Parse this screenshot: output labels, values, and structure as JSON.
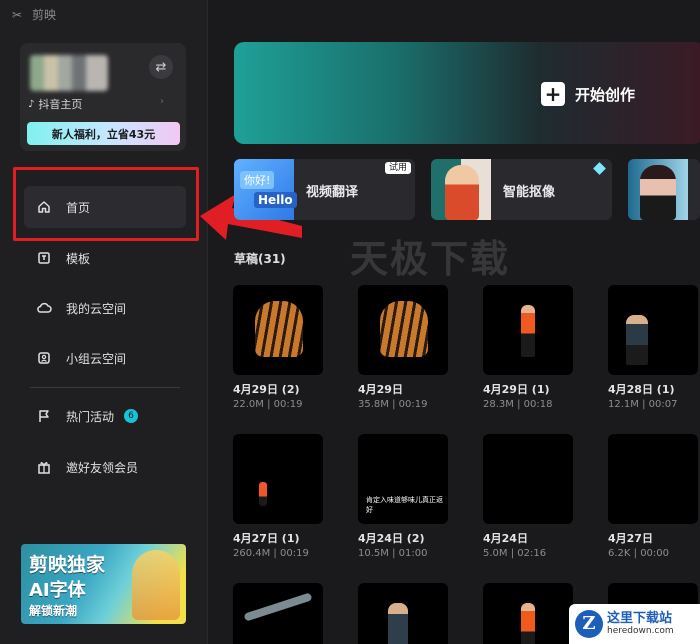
{
  "app": {
    "title": "剪映"
  },
  "user": {
    "douyin_label": "抖音主页",
    "promo": "新人福利，立省43元",
    "switch_icon": "swap-icon"
  },
  "nav": {
    "items": [
      {
        "label": "首页",
        "icon": "home-icon",
        "active": true
      },
      {
        "label": "模板",
        "icon": "template-icon"
      },
      {
        "label": "我的云空间",
        "icon": "cloud-icon"
      },
      {
        "label": "小组云空间",
        "icon": "group-cloud-icon"
      },
      {
        "label": "热门活动",
        "icon": "flag-icon",
        "badge": "6"
      },
      {
        "label": "邀好友领会员",
        "icon": "gift-icon"
      }
    ]
  },
  "banner": {
    "line1": "剪映独家",
    "line2": "AI字体",
    "line3": "解锁新潮"
  },
  "create": {
    "label": "开始创作"
  },
  "tools": [
    {
      "label": "视频翻译",
      "tag": "试用",
      "thumb_text1": "你好!",
      "thumb_text2": "Hello"
    },
    {
      "label": "智能抠像"
    }
  ],
  "watermark": "天极下载",
  "drafts": {
    "title": "草稿(31)",
    "items": [
      {
        "name": "4月29日 (2)",
        "meta": "22.0M | 00:19",
        "thumb": "tiger"
      },
      {
        "name": "4月29日",
        "meta": "35.8M | 00:19",
        "thumb": "tiger"
      },
      {
        "name": "4月29日 (1)",
        "meta": "28.3M | 00:18",
        "thumb": "walk"
      },
      {
        "name": "4月28日 (1)",
        "meta": "12.1M | 00:07",
        "thumb": "road"
      },
      {
        "name": "4月27日 (1)",
        "meta": "260.4M | 00:19",
        "thumb": "avenue"
      },
      {
        "name": "4月24日 (2)",
        "meta": "10.5M | 01:00",
        "thumb": "food",
        "caption": "肯定入味道够味儿真正返好"
      },
      {
        "name": "4月24日",
        "meta": "5.0M | 02:16",
        "thumb": "black"
      },
      {
        "name": "4月27日",
        "meta": "6.2K | 00:00",
        "thumb": "black"
      },
      {
        "thumb": "factory"
      },
      {
        "thumb": "dark-road"
      },
      {
        "thumb": "walk"
      },
      {
        "thumb": "black"
      }
    ]
  },
  "corner_logo": {
    "title": "这里下载站",
    "url": "heredown.com"
  },
  "colors": {
    "highlight": "#e21e25",
    "badge": "#19c3d6",
    "background": "#1a1a1c"
  }
}
